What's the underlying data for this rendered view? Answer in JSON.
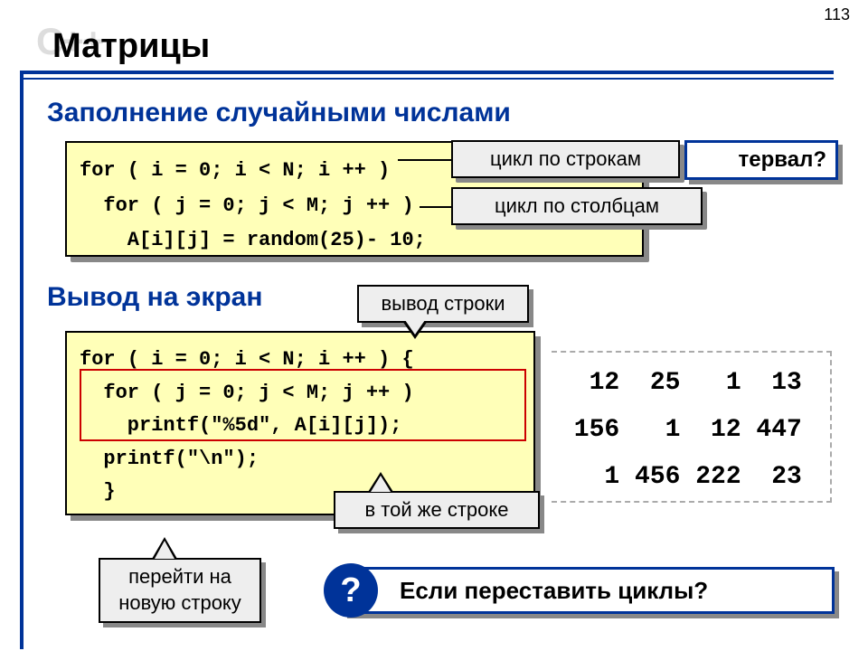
{
  "page_number": "113",
  "watermark": "C++",
  "title": "Матрицы",
  "section1": "Заполнение случайными числами",
  "code1": "for ( i = 0; i < N; i ++ )\n  for ( j = 0; j < M; j ++ )\n    A[i][j] = random(25)- 10;",
  "callout_rows": "цикл по строкам",
  "callout_cols": "цикл по столбцам",
  "partial_question": "тервал?",
  "section2": "Вывод на экран",
  "code2": "for ( i = 0; i < N; i ++ ) {\n  for ( j = 0; j < M; j ++ )\n    printf(\"%5d\", A[i][j]);\n  printf(\"\\n\");\n  }",
  "callout_row_out": "вывод строки",
  "callout_same_line": "в той же строке",
  "callout_newline": "перейти на новую строку",
  "output_text": "  12  25   1  13\n 156   1  12 447\n   1 456 222  23",
  "question_mark": "?",
  "question_text": "Если переставить циклы?"
}
